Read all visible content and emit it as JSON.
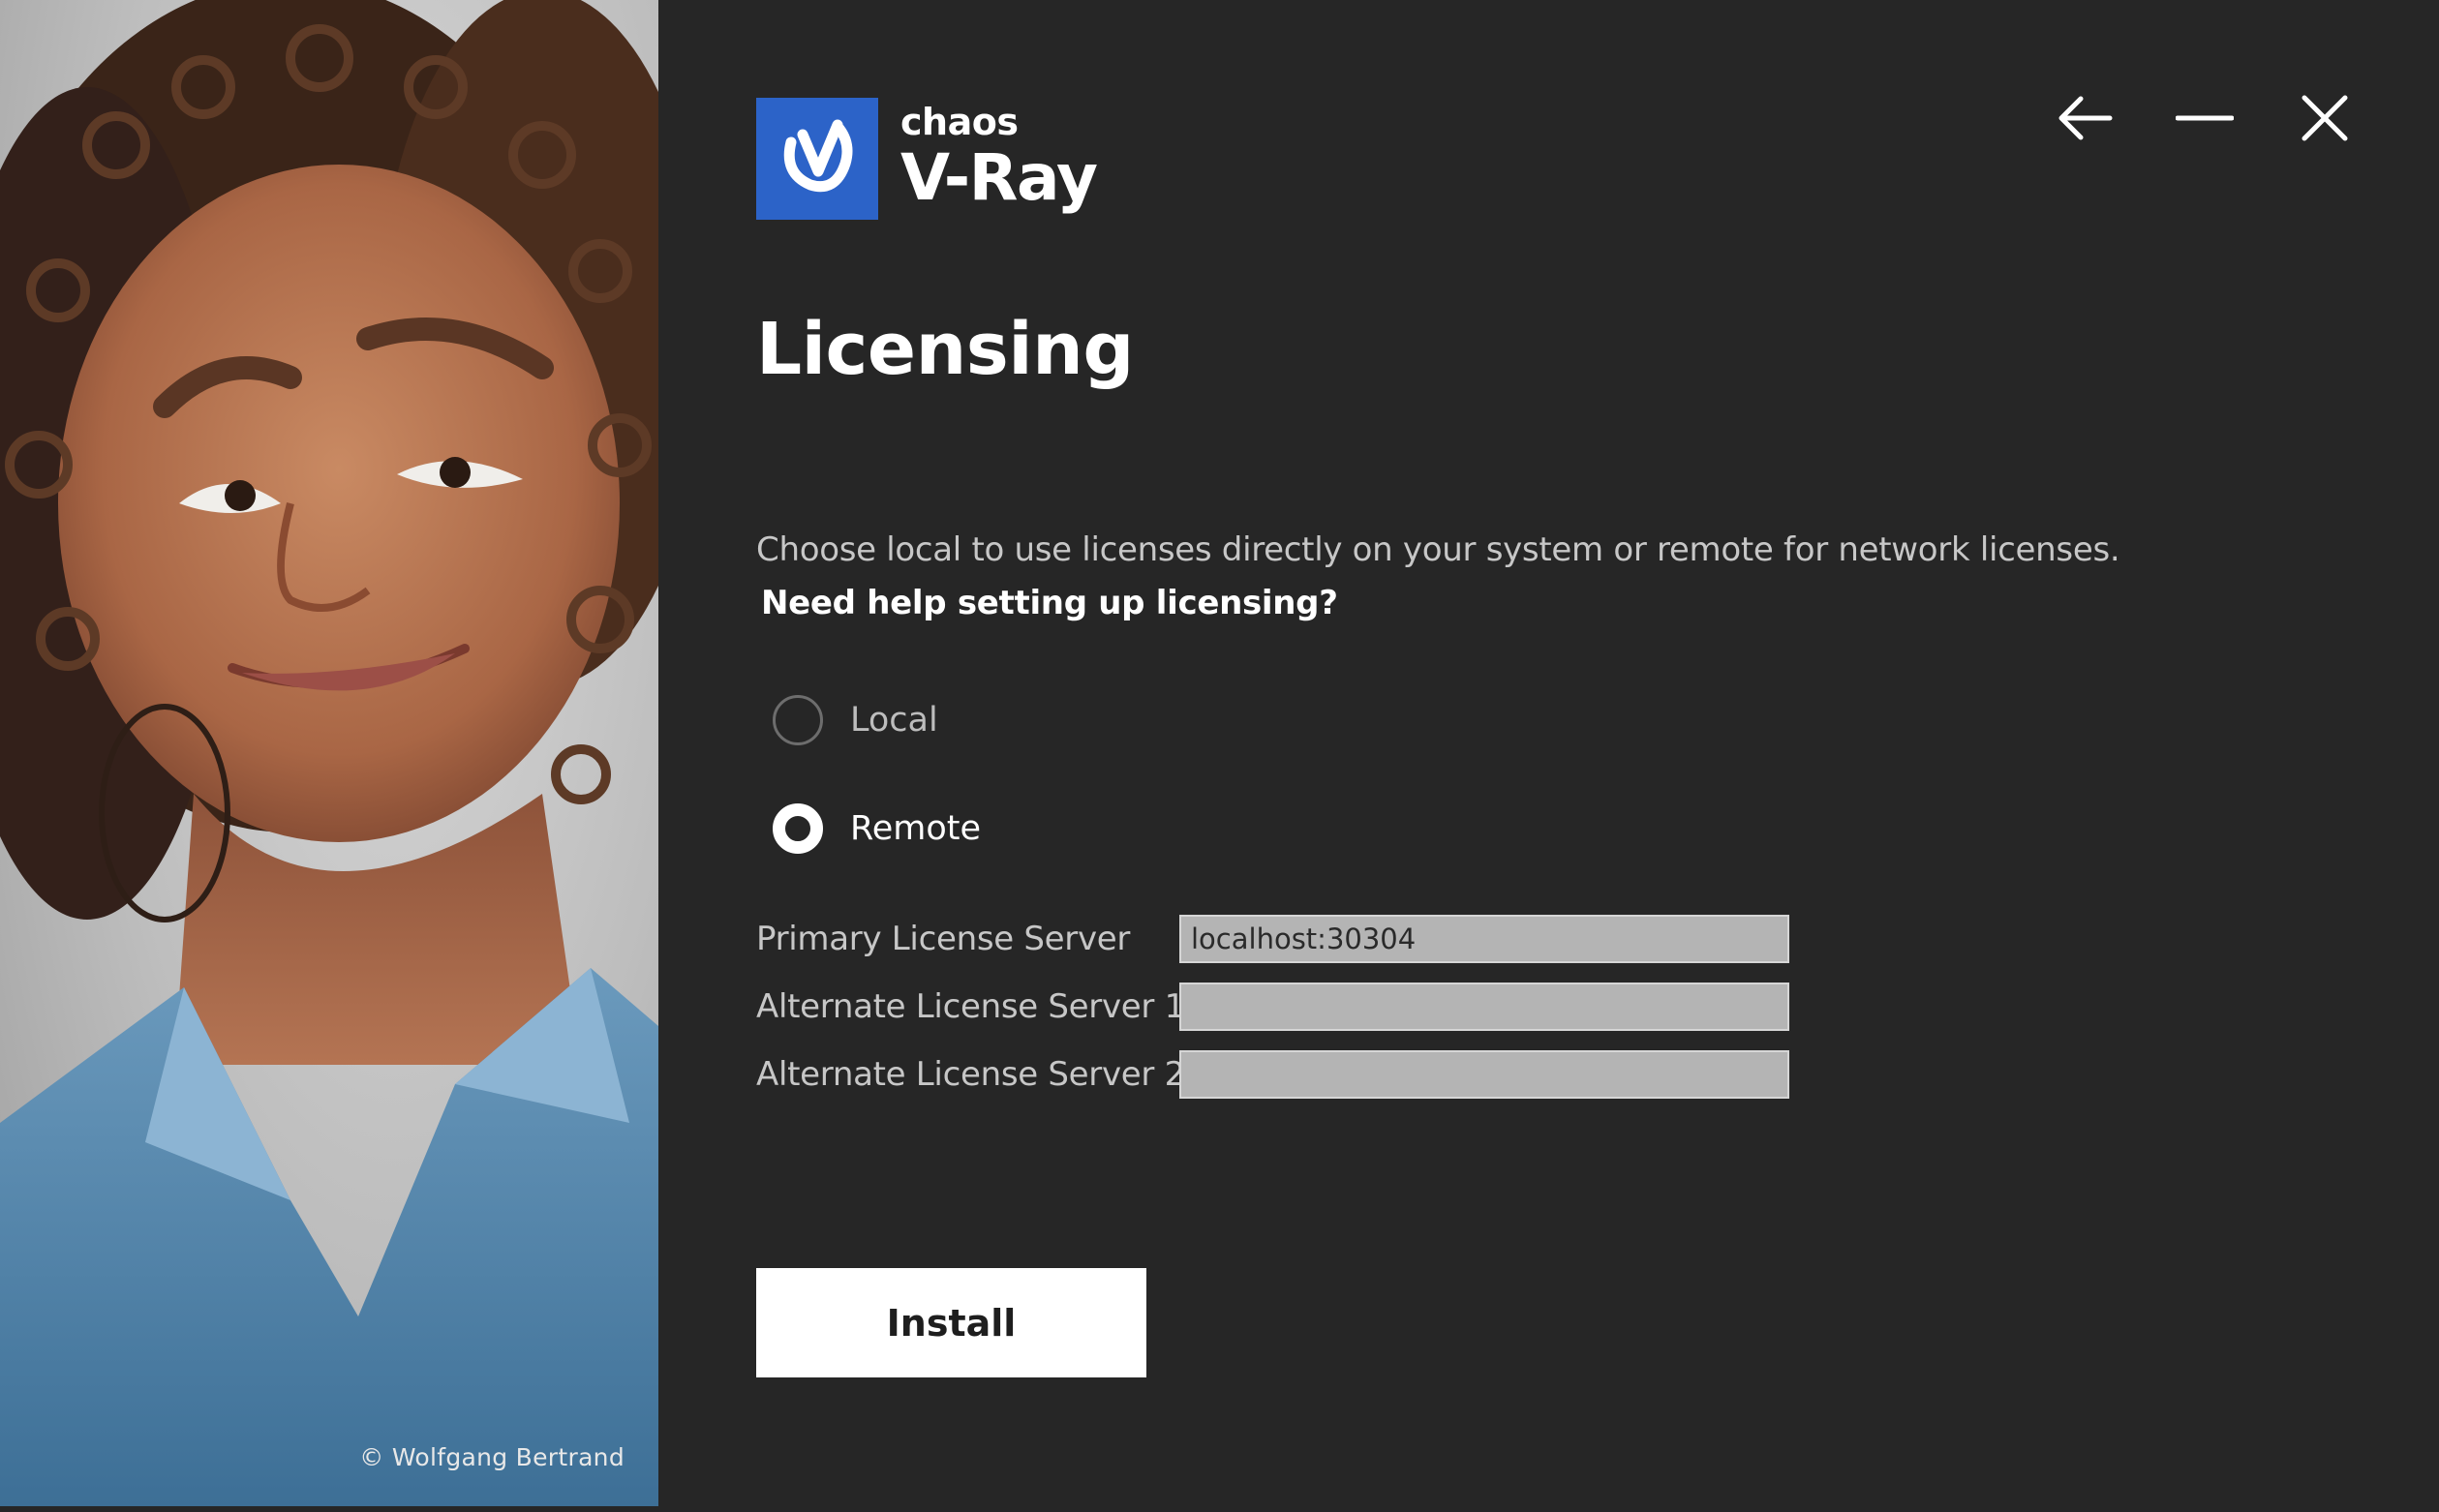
{
  "window": {
    "controls": {
      "back_icon": "arrow-left-icon",
      "minimize_icon": "minimize-icon",
      "close_icon": "close-icon"
    }
  },
  "artwork": {
    "credit": "© Wolfgang Bertrand"
  },
  "logo": {
    "brand": "chaos",
    "product": "V-Ray",
    "mark_icon": "v-ray-logo-icon",
    "mark_color": "#2c63c8"
  },
  "page": {
    "title": "Licensing",
    "description": "Choose local to use licenses directly on your system or remote for network licenses.",
    "help_link": "Need help setting up licensing?"
  },
  "license_mode": {
    "options": [
      {
        "label": "Local",
        "selected": false
      },
      {
        "label": "Remote",
        "selected": true
      }
    ]
  },
  "servers": {
    "primary": {
      "label": "Primary License Server",
      "value": "localhost:30304"
    },
    "alternate_1": {
      "label": "Alternate License Server 1",
      "value": ""
    },
    "alternate_2": {
      "label": "Alternate License Server 2",
      "value": ""
    }
  },
  "actions": {
    "install_label": "Install"
  },
  "colors": {
    "background": "#262626",
    "accent": "#2c63c8",
    "input_bg": "#b4b4b4",
    "button_bg": "#ffffff"
  }
}
